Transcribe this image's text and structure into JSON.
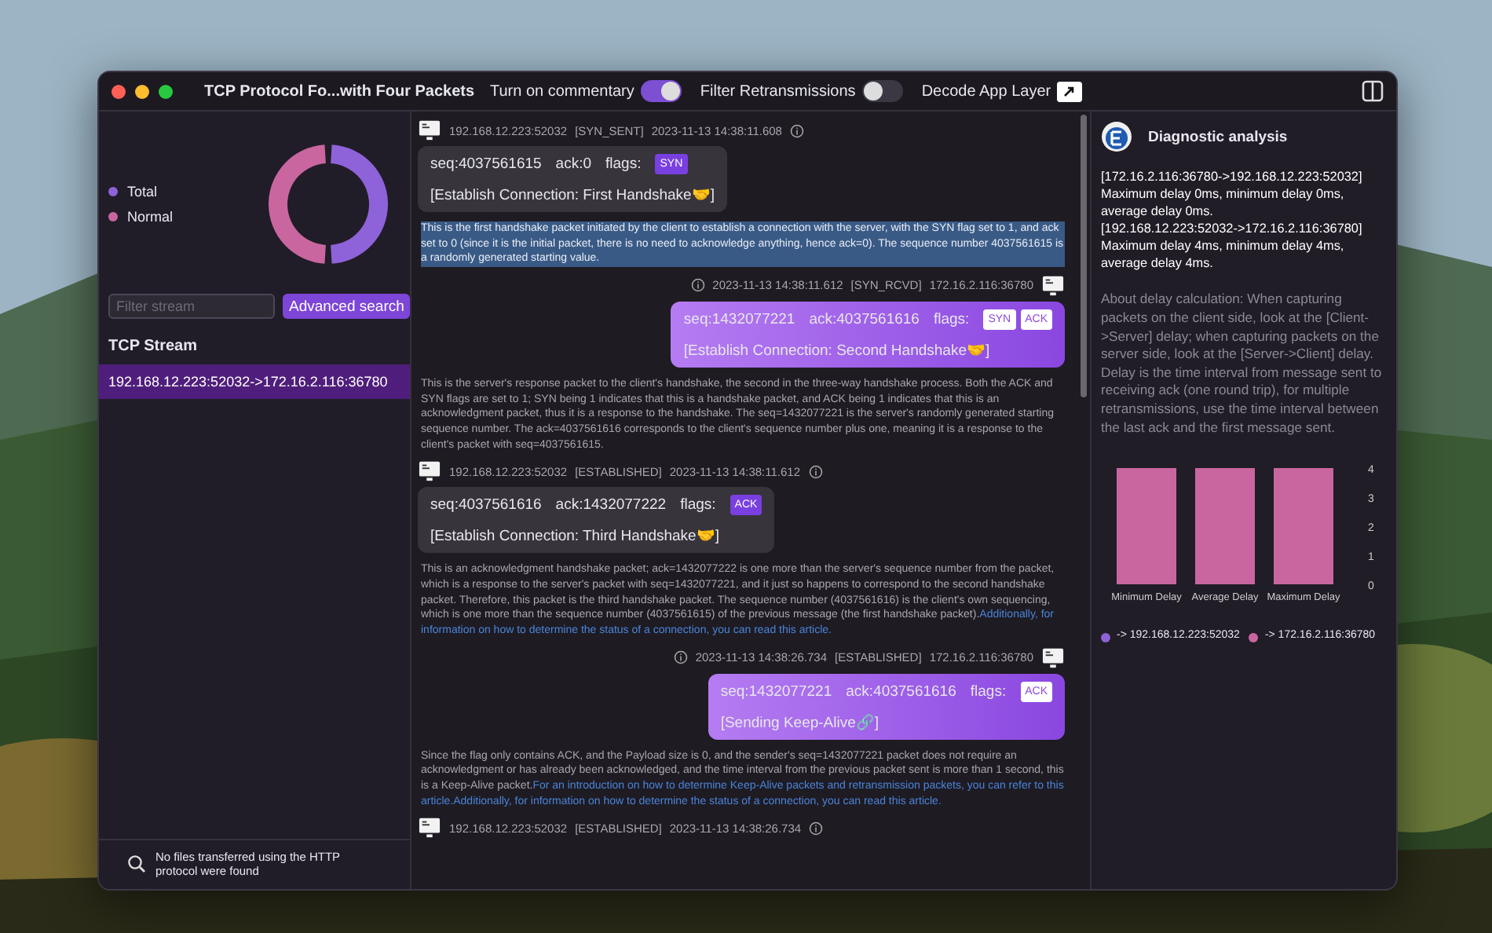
{
  "window": {
    "title": "TCP Protocol Fo...with Four Packets"
  },
  "toolbar": {
    "toggles": [
      {
        "label": "Turn on commentary",
        "on": true
      },
      {
        "label": "Filter Retransmissions",
        "on": false
      }
    ],
    "decode_label": "Decode App Layer"
  },
  "sidebar": {
    "legend": [
      {
        "label": "Total",
        "color": "#8e62d9"
      },
      {
        "label": "Normal",
        "color": "#c9669f"
      }
    ],
    "filter": {
      "placeholder": "Filter stream"
    },
    "advanced_button": "Advanced search",
    "section_title": "TCP Stream",
    "streams": [
      {
        "label": "192.168.12.223:52032->172.16.2.116:36780",
        "selected": true
      }
    ],
    "footer": "No files transferred using the HTTP protocol were found"
  },
  "messages": [
    {
      "kind": "client",
      "address": "192.168.12.223:52032",
      "state": "[SYN_SENT]",
      "time": "2023-11-13 14:38:11.608",
      "seq": "seq:4037561615",
      "ack": "ack:0",
      "flags_label": "flags:",
      "flags": [
        "SYN"
      ],
      "summary": "[Establish Connection: First Handshake🤝]",
      "note": {
        "highlighted": true,
        "parts": [
          {
            "kind": "text",
            "text": "This is the first handshake packet initiated by the client to establish a connection with the server, with the SYN flag set to 1, and ack set to 0 (since it is the initial packet, there is no need to acknowledge anything, hence ack=0). The sequence number 4037561615 is a randomly generated starting value."
          }
        ]
      }
    },
    {
      "kind": "server",
      "address": "172.16.2.116:36780",
      "state": "[SYN_RCVD]",
      "time": "2023-11-13 14:38:11.612",
      "seq": "seq:1432077221",
      "ack": "ack:4037561616",
      "flags_label": "flags:",
      "flags": [
        "SYN",
        "ACK"
      ],
      "summary": "[Establish Connection: Second Handshake🤝]",
      "note": {
        "highlighted": false,
        "parts": [
          {
            "kind": "text",
            "text": "This is the server's response packet to the client's handshake, the second in the three-way handshake process. Both the ACK and SYN flags are set to 1; SYN being 1 indicates that this is a handshake packet, and ACK being 1 indicates that this is an acknowledgment packet, thus it is a response to the handshake. The seq=1432077221 is the server's randomly generated starting sequence number. The ack=4037561616 corresponds to the client's sequence number plus one, meaning it is a response to the client's packet with seq=4037561615."
          }
        ]
      }
    },
    {
      "kind": "client",
      "address": "192.168.12.223:52032",
      "state": "[ESTABLISHED]",
      "time": "2023-11-13 14:38:11.612",
      "seq": "seq:4037561616",
      "ack": "ack:1432077222",
      "flags_label": "flags:",
      "flags": [
        "ACK"
      ],
      "summary": "[Establish Connection: Third Handshake🤝]",
      "note": {
        "highlighted": false,
        "parts": [
          {
            "kind": "text",
            "text": "This is an acknowledgment handshake packet; ack=1432077222 is one more than the server's sequence number from the packet, which is a response to the server's packet with seq=1432077221, and it just so happens to correspond to the second handshake packet. Therefore, this packet is the third handshake packet. The sequence number (4037561616) is the client's own sequencing, which is one more than the sequence number (4037561615) of the previous message (the first handshake packet)."
          },
          {
            "kind": "link",
            "text": "Additionally, for information on how to determine the status of a connection, you can read this article."
          }
        ]
      }
    },
    {
      "kind": "server",
      "address": "172.16.2.116:36780",
      "state": "[ESTABLISHED]",
      "time": "2023-11-13 14:38:26.734",
      "seq": "seq:1432077221",
      "ack": "ack:4037561616",
      "flags_label": "flags:",
      "flags": [
        "ACK"
      ],
      "summary": "[Sending Keep-Alive🔗]",
      "note": {
        "highlighted": false,
        "parts": [
          {
            "kind": "text",
            "text": "Since the flag only contains ACK, and the Payload size is 0, and the sender's seq=1432077221 packet does not require an acknowledgment or has already been acknowledged, and the time interval from the previous packet sent is more than 1 second, this is a Keep-Alive packet."
          },
          {
            "kind": "link",
            "text": "For an introduction on how to determine Keep-Alive packets and retransmission packets, you can refer to this article."
          },
          {
            "kind": "link",
            "text": "Additionally, for information on how to determine the status of a connection, you can read this article."
          }
        ]
      }
    },
    {
      "kind": "client",
      "address": "192.168.12.223:52032",
      "state": "[ESTABLISHED]",
      "time": "2023-11-13 14:38:26.734"
    }
  ],
  "analysis": {
    "title": "Diagnostic analysis",
    "summary": [
      "[172.16.2.116:36780->192.168.12.223:52032] Maximum delay 0ms, minimum delay 0ms, average delay 0ms.",
      "[192.168.12.223:52032->172.16.2.116:36780] Maximum delay 4ms, minimum delay 4ms, average delay 4ms."
    ],
    "about": "About delay calculation: When capturing packets on the client side, look at the [Client->Server] delay; when capturing packets on the server side, look at the [Server->Client] delay. Delay is the time interval from message sent to receiving ack (one round trip), for multiple retransmissions, use the time interval between the last ack and the first message sent.",
    "chart_data": {
      "type": "bar",
      "categories": [
        "Minimum Delay",
        "Average Delay",
        "Maximum Delay"
      ],
      "series": [
        {
          "name": "-> 192.168.12.223:52032",
          "color": "#8e62d9",
          "values": [
            0,
            0,
            0
          ]
        },
        {
          "name": "-> 172.16.2.116:36780",
          "color": "#c9669f",
          "values": [
            4,
            4,
            4
          ]
        }
      ],
      "ylim": [
        0,
        4
      ],
      "yticks": [
        0,
        1,
        2,
        3,
        4
      ]
    }
  }
}
